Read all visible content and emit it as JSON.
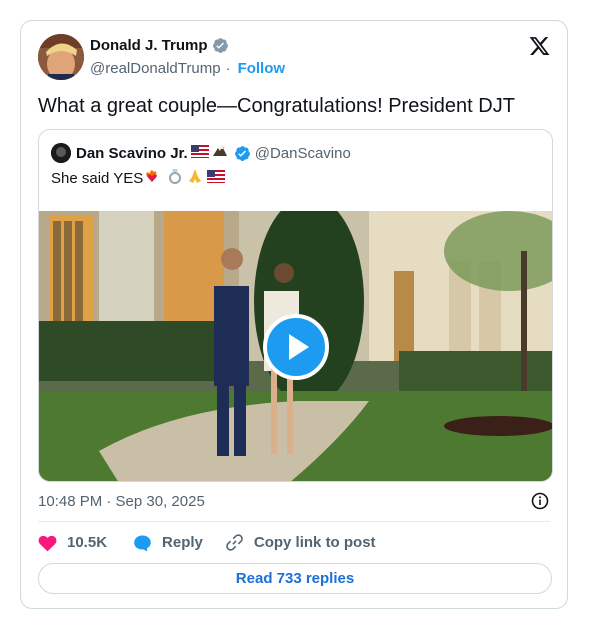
{
  "author": {
    "name": "Donald J. Trump",
    "handle": "@realDonaldTrump",
    "separator": "·",
    "follow_label": "Follow"
  },
  "tweet_text": "What a great couple—Congratulations! President DJT",
  "quoted": {
    "name": "Dan Scavino Jr.",
    "handle": "@DanScavino",
    "text": "She said YES",
    "emojis": [
      "flag-us-emoji",
      "eagle-emoji",
      "heart-on-fire-emoji",
      "ring-emoji",
      "praying-hands-emoji",
      "flag-us-emoji"
    ]
  },
  "timestamp": "10:48 PM · Sep 30, 2025",
  "actions": {
    "likes_count": "10.5K",
    "reply_label": "Reply",
    "copy_label": "Copy link to post"
  },
  "read_replies_label": "Read 733 replies",
  "colors": {
    "accent": "#1d9bf0",
    "like": "#f91880",
    "text_secondary": "#536471",
    "border": "#cfd9de"
  }
}
